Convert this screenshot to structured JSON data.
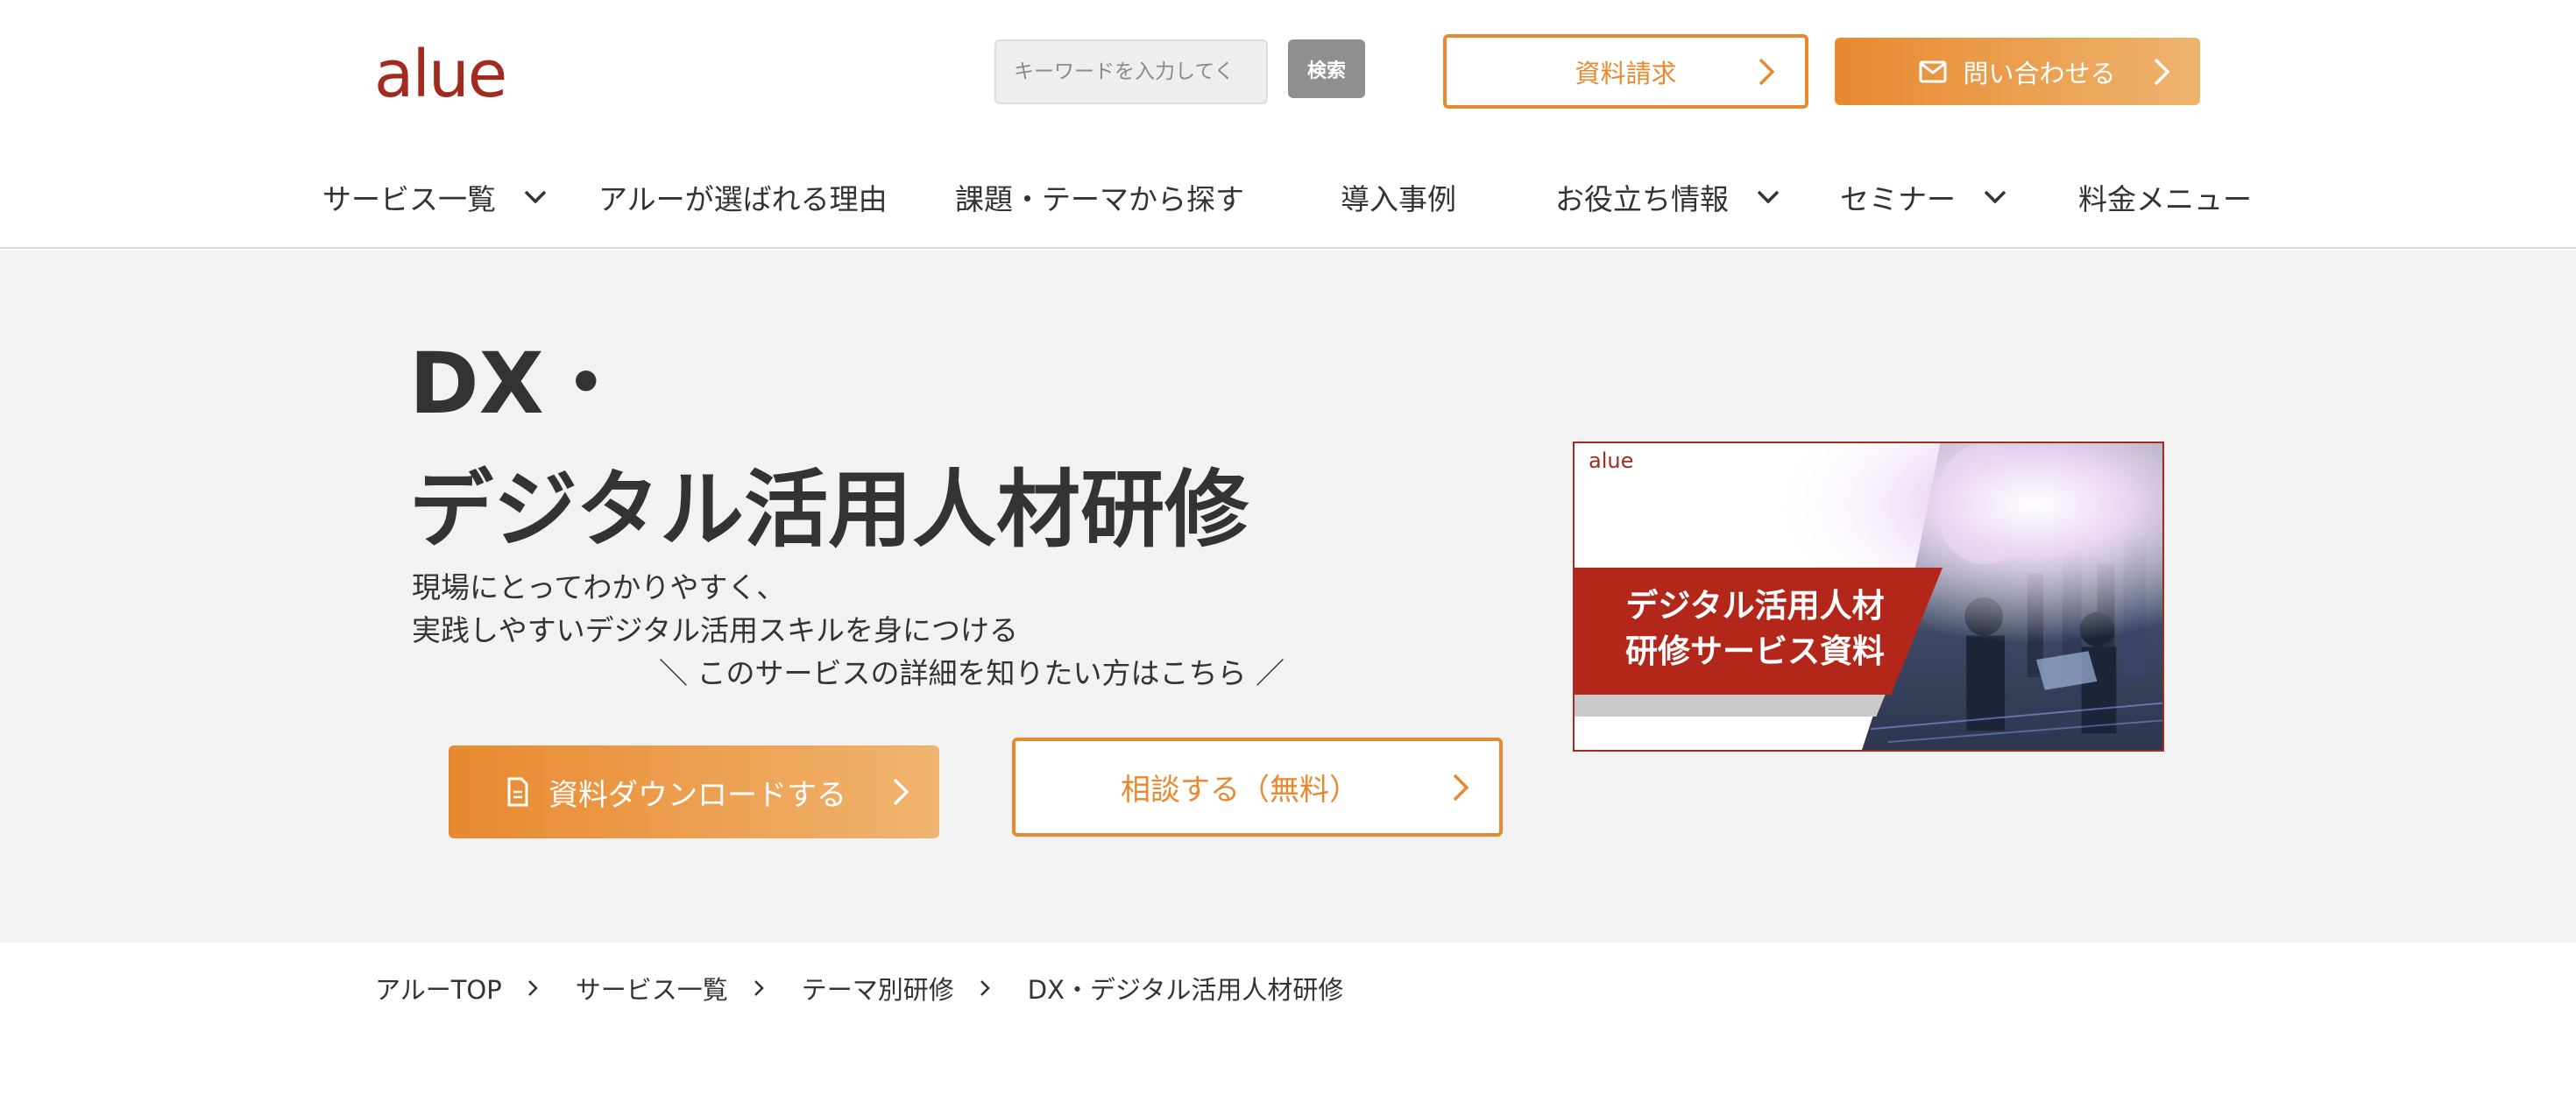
{
  "header": {
    "logo_text": "alue",
    "search": {
      "placeholder": "キーワードを入力してく",
      "button_label": "検索"
    },
    "request_label": "資料請求",
    "contact_label": "問い合わせる",
    "accent_color": "#e8892f",
    "brand_color": "#a22a1e"
  },
  "nav": {
    "items": [
      {
        "label": "サービス一覧",
        "has_dropdown": true
      },
      {
        "label": "アルーが選ばれる理由",
        "has_dropdown": false
      },
      {
        "label": "課題・テーマから探す",
        "has_dropdown": false
      },
      {
        "label": "導入事例",
        "has_dropdown": false
      },
      {
        "label": "お役立ち情報",
        "has_dropdown": true
      },
      {
        "label": "セミナー",
        "has_dropdown": true
      },
      {
        "label": "料金メニュー",
        "has_dropdown": false
      }
    ]
  },
  "hero": {
    "title_line1": "DX・",
    "title_line2": "デジタル活用人材研修",
    "subtitle_line1": "現場にとってわかりやすく、",
    "subtitle_line2": "実践しやすいデジタル活用スキルを身につける",
    "note": "＼ このサービスの詳細を知りたい方はこちら ／",
    "download_label": "資料ダウンロードする",
    "consult_label": "相談する（無料）",
    "banner": {
      "logo_text": "alue",
      "line1": "デジタル活用人材",
      "line2": "研修サービス資料"
    }
  },
  "breadcrumb": {
    "items": [
      "アルーTOP",
      "サービス一覧",
      "テーマ別研修",
      "DX・デジタル活用人材研修"
    ]
  }
}
